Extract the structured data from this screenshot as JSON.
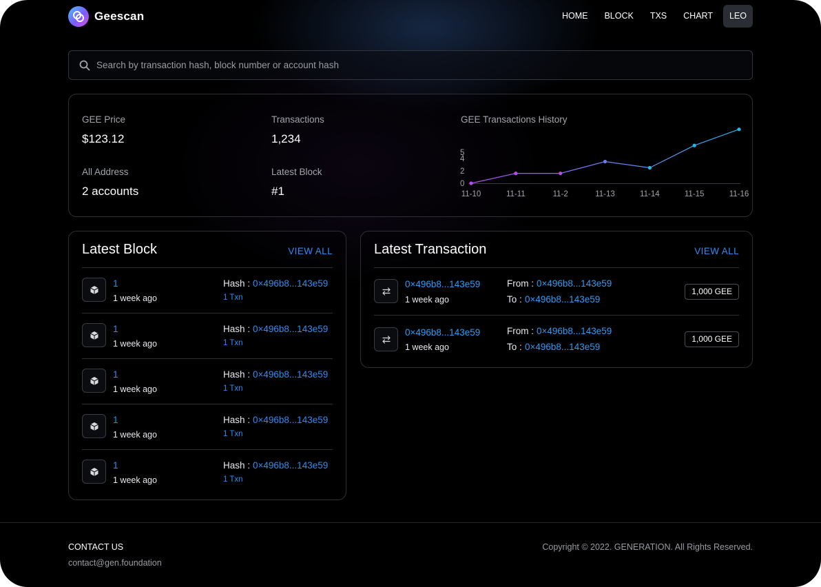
{
  "brand": {
    "name": "Geescan"
  },
  "nav": {
    "items": [
      "HOME",
      "BLOCK",
      "TXS",
      "CHART"
    ],
    "user": "LEO"
  },
  "search": {
    "placeholder": "Search by transaction hash, block number or account hash"
  },
  "stats": {
    "price_label": "GEE Price",
    "price_value": "$123.12",
    "tx_label": "Transactions",
    "tx_value": "1,234",
    "address_label": "All Address",
    "address_value": "2 accounts",
    "block_label": "Latest Block",
    "block_value": "#1"
  },
  "chart_data": {
    "type": "line",
    "title": "GEE Transactions History",
    "categories": [
      "11-10",
      "11-11",
      "11-2",
      "11-13",
      "11-14",
      "11-15",
      "11-16"
    ],
    "values": [
      0,
      1.6,
      1.6,
      3.5,
      2.5,
      6.1,
      8.7
    ],
    "yticks": [
      0,
      2,
      4,
      5
    ],
    "ylim": [
      0,
      9
    ],
    "colors": {
      "start": "#b44cf0",
      "end": "#22b8f0"
    }
  },
  "latest_block": {
    "title": "Latest Block",
    "view_all": "VIEW ALL",
    "rows": [
      {
        "number": "1",
        "age": "1 week ago",
        "hash_label": "Hash :",
        "hash": "0×496b8...143e59",
        "txn": "1 Txn"
      },
      {
        "number": "1",
        "age": "1 week ago",
        "hash_label": "Hash :",
        "hash": "0×496b8...143e59",
        "txn": "1 Txn"
      },
      {
        "number": "1",
        "age": "1 week ago",
        "hash_label": "Hash :",
        "hash": "0×496b8...143e59",
        "txn": "1 Txn"
      },
      {
        "number": "1",
        "age": "1 week ago",
        "hash_label": "Hash :",
        "hash": "0×496b8...143e59",
        "txn": "1 Txn"
      },
      {
        "number": "1",
        "age": "1 week ago",
        "hash_label": "Hash :",
        "hash": "0×496b8...143e59",
        "txn": "1 Txn"
      }
    ]
  },
  "latest_transaction": {
    "title": "Latest Transaction",
    "view_all": "VIEW ALL",
    "rows": [
      {
        "hash": "0×496b8...143e59",
        "age": "1 week ago",
        "from_label": "From :",
        "from": "0×496b8...143e59",
        "to_label": "To :",
        "to": "0×496b8...143e59",
        "amount": "1,000 GEE"
      },
      {
        "hash": "0×496b8...143e59",
        "age": "1 week ago",
        "from_label": "From :",
        "from": "0×496b8...143e59",
        "to_label": "To :",
        "to": "0×496b8...143e59",
        "amount": "1,000 GEE"
      }
    ]
  },
  "footer": {
    "contact_title": "CONTACT US",
    "contact_email": "contact@gen.foundation",
    "copyright": "Copyright © 2022. GENERATION. All Rights Reserved."
  }
}
